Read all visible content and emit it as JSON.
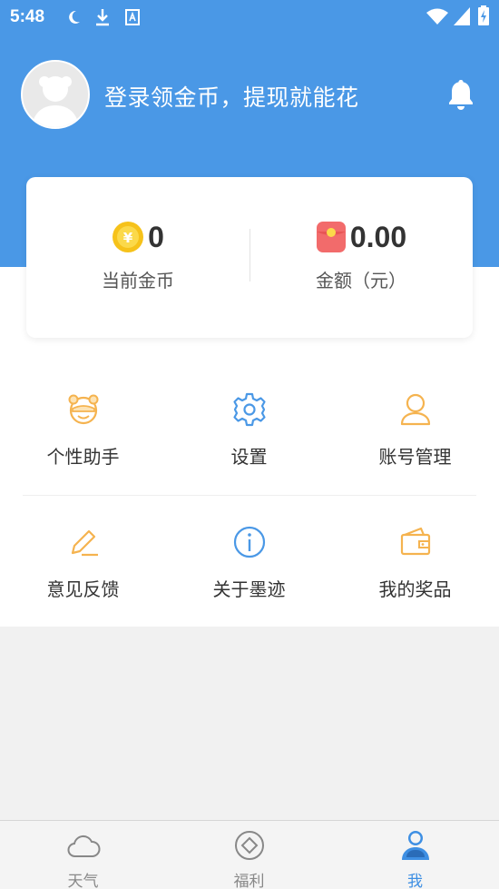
{
  "status_bar": {
    "time": "5:48"
  },
  "header": {
    "login_prompt": "登录领金币，提现就能花"
  },
  "stats": {
    "coins": {
      "value": "0",
      "label": "当前金币"
    },
    "amount": {
      "value": "0.00",
      "label": "金额（元）"
    }
  },
  "menu": {
    "row1": [
      {
        "label": "个性助手",
        "icon": "assistant-face-icon"
      },
      {
        "label": "设置",
        "icon": "gear-icon"
      },
      {
        "label": "账号管理",
        "icon": "user-icon"
      }
    ],
    "row2": [
      {
        "label": "意见反馈",
        "icon": "pencil-icon"
      },
      {
        "label": "关于墨迹",
        "icon": "info-icon"
      },
      {
        "label": "我的奖品",
        "icon": "wallet-icon"
      }
    ]
  },
  "bottom_nav": [
    {
      "label": "天气",
      "icon": "cloud-icon",
      "active": false
    },
    {
      "label": "福利",
      "icon": "diamond-coin-icon",
      "active": false
    },
    {
      "label": "我",
      "icon": "profile-icon",
      "active": true
    }
  ],
  "colors": {
    "header_bg": "#4a98e6",
    "accent_orange": "#f5b34f",
    "accent_blue": "#3e8fe3",
    "nav_active": "#3e8fe3"
  }
}
